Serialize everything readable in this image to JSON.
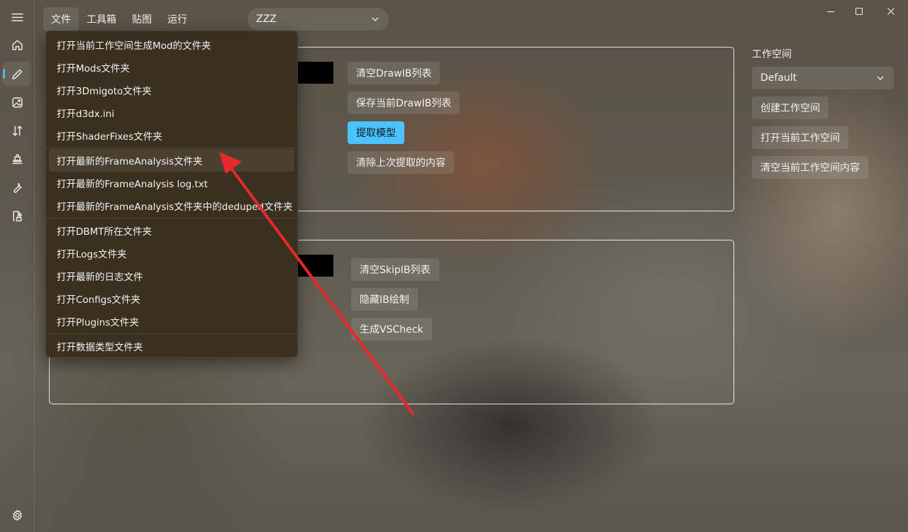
{
  "menubar": {
    "file": "文件",
    "toolbox": "工具箱",
    "texture": "贴图",
    "run": "运行"
  },
  "game_select": {
    "value": "ZZZ"
  },
  "file_menu": {
    "items": [
      "打开当前工作空间生成Mod的文件夹",
      "打开Mods文件夹",
      "打开3Dmigoto文件夹",
      "打开d3dx.ini",
      "打开ShaderFixes文件夹",
      "打开最新的FrameAnalysis文件夹",
      "打开最新的FrameAnalysis log.txt",
      "打开最新的FrameAnalysis文件夹中的deduped文件夹",
      "打开DBMT所在文件夹",
      "打开Logs文件夹",
      "打开最新的日志文件",
      "打开Configs文件夹",
      "打开Plugins文件夹",
      "打开数据类型文件夹"
    ],
    "hovered_index": 5
  },
  "drawib_panel": {
    "clear_label": "清空DrawIB列表",
    "save_label": "保存当前DrawIB列表",
    "extract_label": "提取模型",
    "clear_last_label": "清除上次提取的内容"
  },
  "skipib_panel": {
    "clear_label": "清空SkipIB列表",
    "hide_label": "隐藏IB绘制",
    "vscheck_label": "生成VSCheck"
  },
  "workspace": {
    "label": "工作空间",
    "selected": "Default",
    "create_label": "创建工作空间",
    "open_label": "打开当前工作空间",
    "clear_label": "清空当前工作空间内容"
  },
  "colors": {
    "accent": "#4cc2ff",
    "annotation_arrow": "#e8282b",
    "menu_bg": "#3a3020"
  },
  "icons": {
    "rail": [
      "hamburger-icon",
      "home-icon",
      "pencil-icon",
      "image-icon",
      "sort-icon",
      "stamp-icon",
      "wrench-icon",
      "document-lock-icon",
      "gear-icon"
    ]
  }
}
